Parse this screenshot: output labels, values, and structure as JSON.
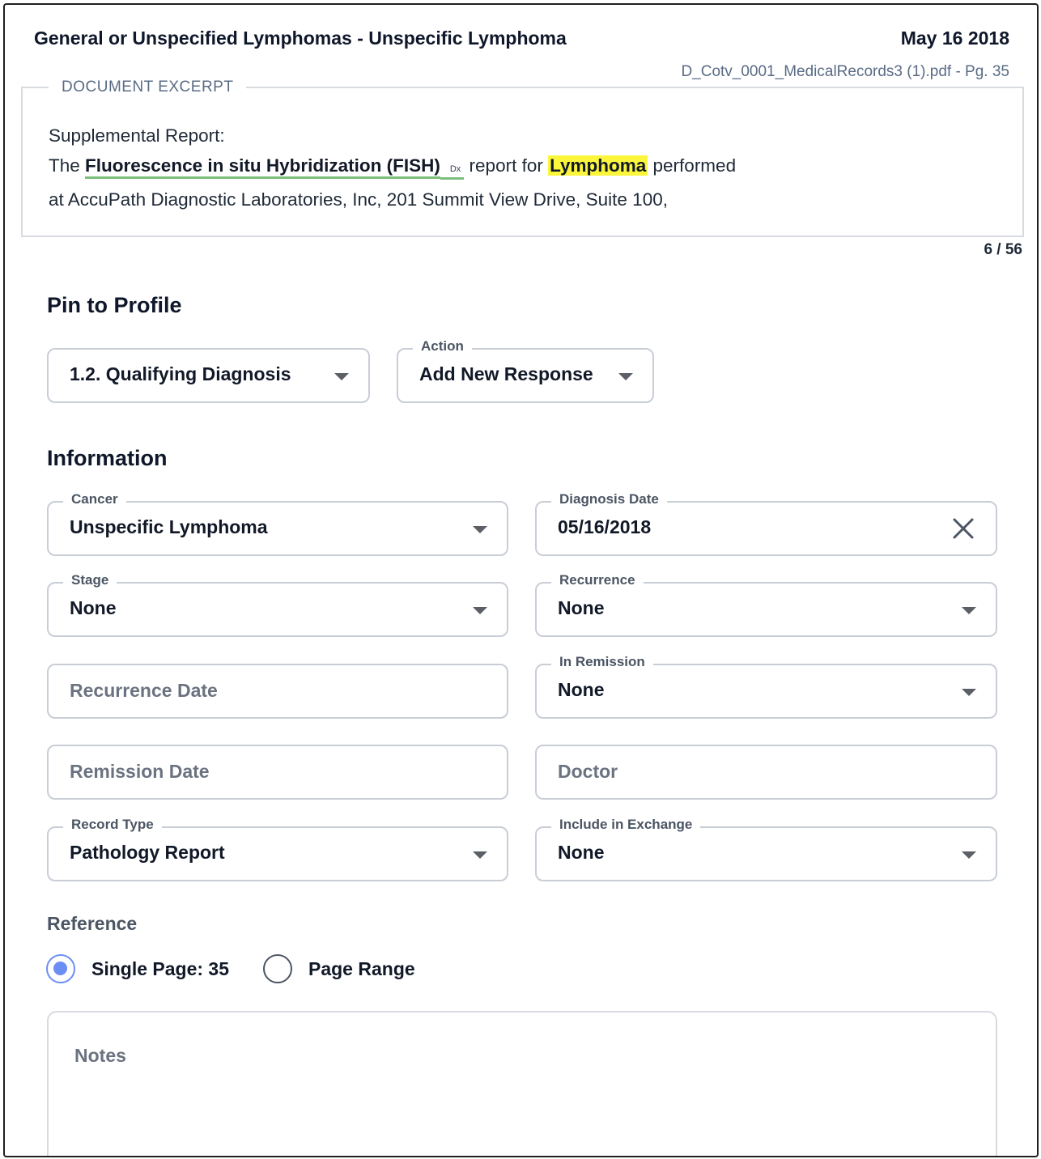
{
  "header": {
    "title": "General or Unspecified Lymphomas - Unspecific Lymphoma",
    "date": "May 16 2018",
    "file_ref": "D_Cotv_0001_MedicalRecords3 (1).pdf - Pg. 35"
  },
  "excerpt": {
    "legend": "DOCUMENT EXCERPT",
    "line1": "Supplemental Report:",
    "line2_prefix": "The ",
    "link_text": "Fluorescence in situ Hybridization (FISH)",
    "link_tag": "Dx",
    "line2_mid": " report for ",
    "highlight": "Lymphoma",
    "line2_suffix": " performed",
    "line3": "at AccuPath Diagnostic Laboratories, Inc, 201 Summit View Drive, Suite 100,",
    "counter": "6 / 56"
  },
  "pin": {
    "heading": "Pin to Profile",
    "profile_value": "1.2. Qualifying Diagnosis",
    "action_label": "Action",
    "action_value": "Add New Response"
  },
  "info": {
    "heading": "Information",
    "cancer": {
      "label": "Cancer",
      "value": "Unspecific Lymphoma"
    },
    "diagnosis_date": {
      "label": "Diagnosis Date",
      "value": "05/16/2018"
    },
    "stage": {
      "label": "Stage",
      "value": "None"
    },
    "recurrence": {
      "label": "Recurrence",
      "value": "None"
    },
    "recurrence_date": {
      "placeholder": "Recurrence Date"
    },
    "in_remission": {
      "label": "In Remission",
      "value": "None"
    },
    "remission_date": {
      "placeholder": "Remission Date"
    },
    "doctor": {
      "placeholder": "Doctor"
    },
    "record_type": {
      "label": "Record Type",
      "value": "Pathology Report"
    },
    "include_exchange": {
      "label": "Include in Exchange",
      "value": "None"
    }
  },
  "reference": {
    "heading": "Reference",
    "single_label": "Single Page: 35",
    "range_label": "Page Range",
    "selected": "single"
  },
  "notes": {
    "placeholder": "Notes"
  },
  "colors": {
    "accent": "#6b8ef5",
    "highlight": "#fbf53b",
    "link_underline": "#7bbf7b"
  }
}
